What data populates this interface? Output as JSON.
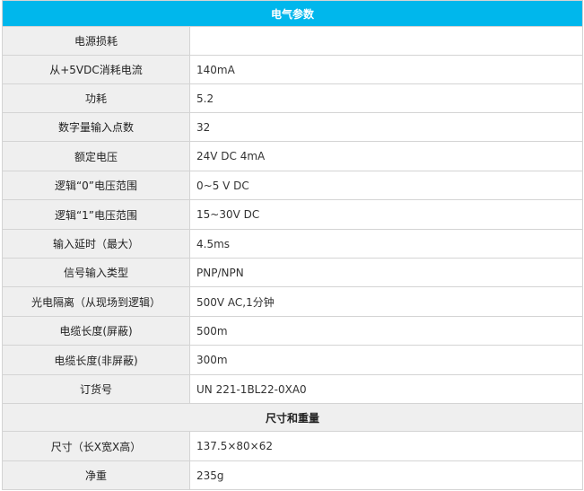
{
  "header": "电气参数",
  "electrical_rows": [
    {
      "label": "电源损耗",
      "value": ""
    },
    {
      "label": "从+5VDC消耗电流",
      "value": "140mA"
    },
    {
      "label": "功耗",
      "value": "5.2"
    },
    {
      "label": "数字量输入点数",
      "value": "32"
    },
    {
      "label": "额定电压",
      "value": "24V DC  4mA"
    },
    {
      "label": "逻辑“0”电压范围",
      "value": "0~5 V DC"
    },
    {
      "label": "逻辑“1”电压范围",
      "value": "15~30V DC"
    },
    {
      "label": "输入延时（最大）",
      "value": "4.5ms"
    },
    {
      "label": "信号输入类型",
      "value": "PNP/NPN"
    },
    {
      "label": "光电隔离（从现场到逻辑）",
      "value": "500V AC,1分钟"
    },
    {
      "label": "电缆长度(屏蔽)",
      "value": "500m"
    },
    {
      "label": "电缆长度(非屏蔽)",
      "value": "300m"
    },
    {
      "label": "订货号",
      "value": "UN 221-1BL22-0XA0"
    }
  ],
  "section2": "尺寸和重量",
  "dimension_rows": [
    {
      "label": "尺寸（长X宽X高）",
      "value": "137.5×80×62"
    },
    {
      "label": "净重",
      "value": "235g"
    }
  ]
}
